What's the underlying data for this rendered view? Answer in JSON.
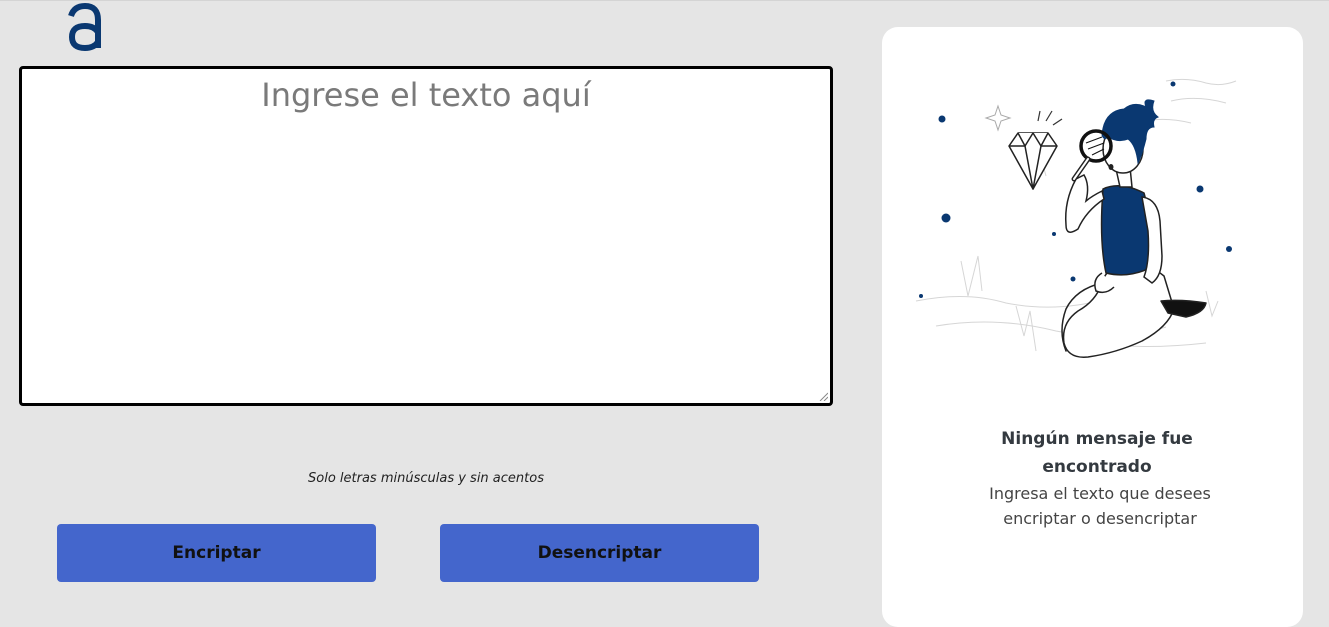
{
  "brand": {
    "logo_letter": "a",
    "color": "#0a3871"
  },
  "input": {
    "value": "",
    "placeholder": "Ingrese el texto aquí"
  },
  "hint": "Solo letras minúsculas y sin acentos",
  "buttons": {
    "encrypt_label": "Encriptar",
    "decrypt_label": "Desencriptar",
    "color": "#4466cc"
  },
  "output_panel": {
    "illustration_icon": "person-with-magnifier-and-diamond-illustration",
    "title": "Ningún mensaje fue encontrado",
    "subtitle": "Ingresa el texto que desees encriptar o desencriptar"
  }
}
